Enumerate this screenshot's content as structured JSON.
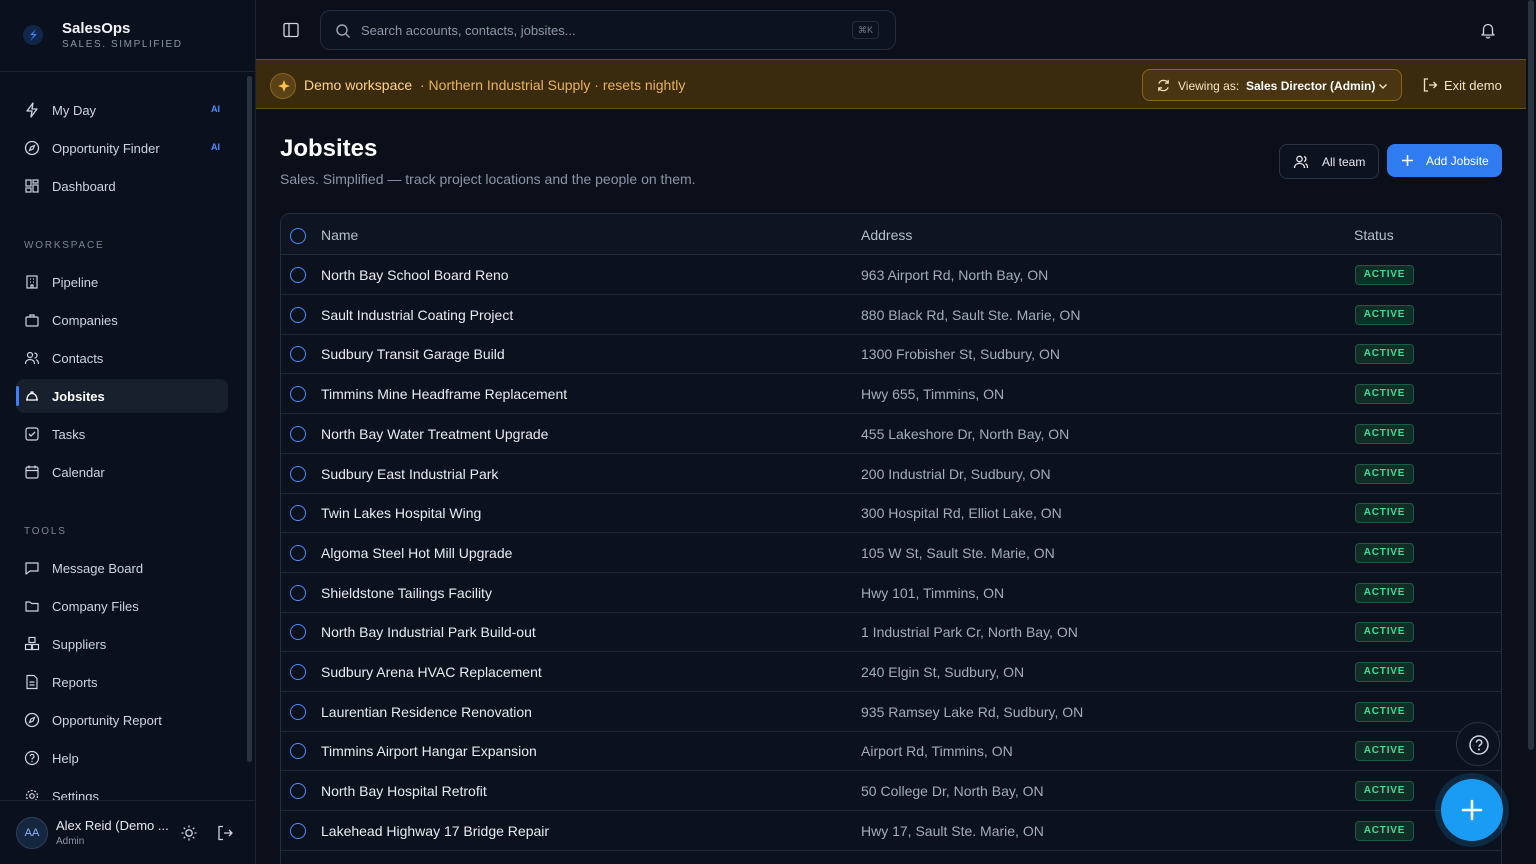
{
  "brand": {
    "name": "SalesOps",
    "tagline": "SALES. SIMPLIFIED"
  },
  "nav": {
    "primary": [
      {
        "label": "My Day",
        "badge": "AI",
        "icon": "bolt-icon"
      },
      {
        "label": "Opportunity Finder",
        "badge": "AI",
        "icon": "compass-icon"
      },
      {
        "label": "Dashboard",
        "badge": "",
        "icon": "dashboard-icon"
      }
    ],
    "workspace_label": "WORKSPACE",
    "workspace": [
      {
        "label": "Pipeline",
        "icon": "building-icon"
      },
      {
        "label": "Companies",
        "icon": "briefcase-icon"
      },
      {
        "label": "Contacts",
        "icon": "users-icon"
      },
      {
        "label": "Jobsites",
        "icon": "hardhat-icon",
        "active": true
      },
      {
        "label": "Tasks",
        "icon": "checkbox-icon"
      },
      {
        "label": "Calendar",
        "icon": "calendar-icon"
      }
    ],
    "tools_label": "TOOLS",
    "tools": [
      {
        "label": "Message Board",
        "icon": "message-icon"
      },
      {
        "label": "Company Files",
        "icon": "folder-icon"
      },
      {
        "label": "Suppliers",
        "icon": "boxes-icon"
      },
      {
        "label": "Reports",
        "icon": "report-icon"
      },
      {
        "label": "Opportunity Report",
        "icon": "compass-icon"
      },
      {
        "label": "Help",
        "icon": "help-icon"
      },
      {
        "label": "Settings",
        "icon": "gear-icon"
      }
    ]
  },
  "user": {
    "initials": "AA",
    "name": "Alex Reid (Demo ...",
    "role": "Admin"
  },
  "search": {
    "placeholder": "Search accounts, contacts, jobsites...",
    "shortcut": "⌘K"
  },
  "banner": {
    "title": "Demo workspace",
    "subtitle": "· Northern Industrial Supply · resets nightly",
    "viewing_label": "Viewing as:",
    "viewing_value": "Sales Director (Admin)",
    "exit_label": "Exit demo"
  },
  "page": {
    "title": "Jobsites",
    "subtitle": "Sales. Simplified — track project locations and the people on them.",
    "team_button": "All team",
    "add_button": "Add Jobsite"
  },
  "table": {
    "columns": [
      "Name",
      "Address",
      "Status"
    ],
    "rows": [
      {
        "name": "North Bay School Board Reno",
        "address": "963 Airport Rd, North Bay, ON",
        "status": "ACTIVE"
      },
      {
        "name": "Sault Industrial Coating Project",
        "address": "880 Black Rd, Sault Ste. Marie, ON",
        "status": "ACTIVE"
      },
      {
        "name": "Sudbury Transit Garage Build",
        "address": "1300 Frobisher St, Sudbury, ON",
        "status": "ACTIVE"
      },
      {
        "name": "Timmins Mine Headframe Replacement",
        "address": "Hwy 655, Timmins, ON",
        "status": "ACTIVE"
      },
      {
        "name": "North Bay Water Treatment Upgrade",
        "address": "455 Lakeshore Dr, North Bay, ON",
        "status": "ACTIVE"
      },
      {
        "name": "Sudbury East Industrial Park",
        "address": "200 Industrial Dr, Sudbury, ON",
        "status": "ACTIVE"
      },
      {
        "name": "Twin Lakes Hospital Wing",
        "address": "300 Hospital Rd, Elliot Lake, ON",
        "status": "ACTIVE"
      },
      {
        "name": "Algoma Steel Hot Mill Upgrade",
        "address": "105 W St, Sault Ste. Marie, ON",
        "status": "ACTIVE"
      },
      {
        "name": "Shieldstone Tailings Facility",
        "address": "Hwy 101, Timmins, ON",
        "status": "ACTIVE"
      },
      {
        "name": "North Bay Industrial Park Build-out",
        "address": "1 Industrial Park Cr, North Bay, ON",
        "status": "ACTIVE"
      },
      {
        "name": "Sudbury Arena HVAC Replacement",
        "address": "240 Elgin St, Sudbury, ON",
        "status": "ACTIVE"
      },
      {
        "name": "Laurentian Residence Renovation",
        "address": "935 Ramsey Lake Rd, Sudbury, ON",
        "status": "ACTIVE"
      },
      {
        "name": "Timmins Airport Hangar Expansion",
        "address": "Airport Rd, Timmins, ON",
        "status": "ACTIVE"
      },
      {
        "name": "North Bay Hospital Retrofit",
        "address": "50 College Dr, North Bay, ON",
        "status": "ACTIVE"
      },
      {
        "name": "Lakehead Highway 17 Bridge Repair",
        "address": "Hwy 17, Sault Ste. Marie, ON",
        "status": "ACTIVE"
      }
    ]
  },
  "colors": {
    "accent": "#2f7bf0",
    "active_status": "#3ddc97",
    "banner": "#3a2a0e"
  }
}
